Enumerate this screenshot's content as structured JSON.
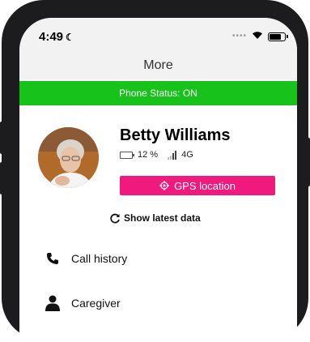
{
  "status_bar": {
    "time": "4:49",
    "battery_level": 0.8
  },
  "header": {
    "title": "More"
  },
  "banner": {
    "text": "Phone Status: ON",
    "color": "#17c21a"
  },
  "profile": {
    "name": "Betty Williams",
    "battery": "12 %",
    "network": "4G"
  },
  "actions": {
    "gps_label": "GPS location",
    "gps_color": "#f0197d",
    "refresh_label": "Show latest data"
  },
  "menu": [
    {
      "label": "Call history",
      "icon": "phone-icon"
    },
    {
      "label": "Caregiver",
      "icon": "person-icon"
    }
  ]
}
